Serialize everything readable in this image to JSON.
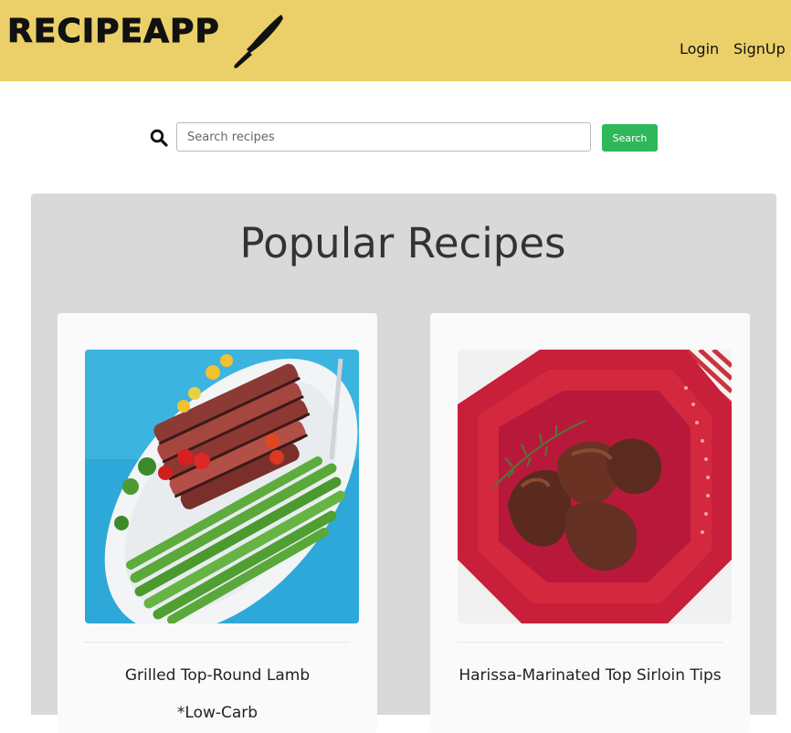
{
  "navbar": {
    "brand": "RecipeApp",
    "login": "Login",
    "signup": "SignUp",
    "background": "#ebd06a"
  },
  "search": {
    "placeholder": "Search recipes",
    "value": "",
    "button_label": "Search",
    "button_color": "#2fb85a",
    "icon": "search-icon"
  },
  "popular": {
    "title": "Popular Recipes",
    "recipes": [
      {
        "title": "Grilled Top-Round Lamb",
        "tag": "*Low-Carb",
        "image": "lamb-asparagus-photo"
      },
      {
        "title": "Harissa-Marinated Top Sirloin Tips",
        "tag": "",
        "image": "sirloin-tips-photo"
      }
    ]
  }
}
